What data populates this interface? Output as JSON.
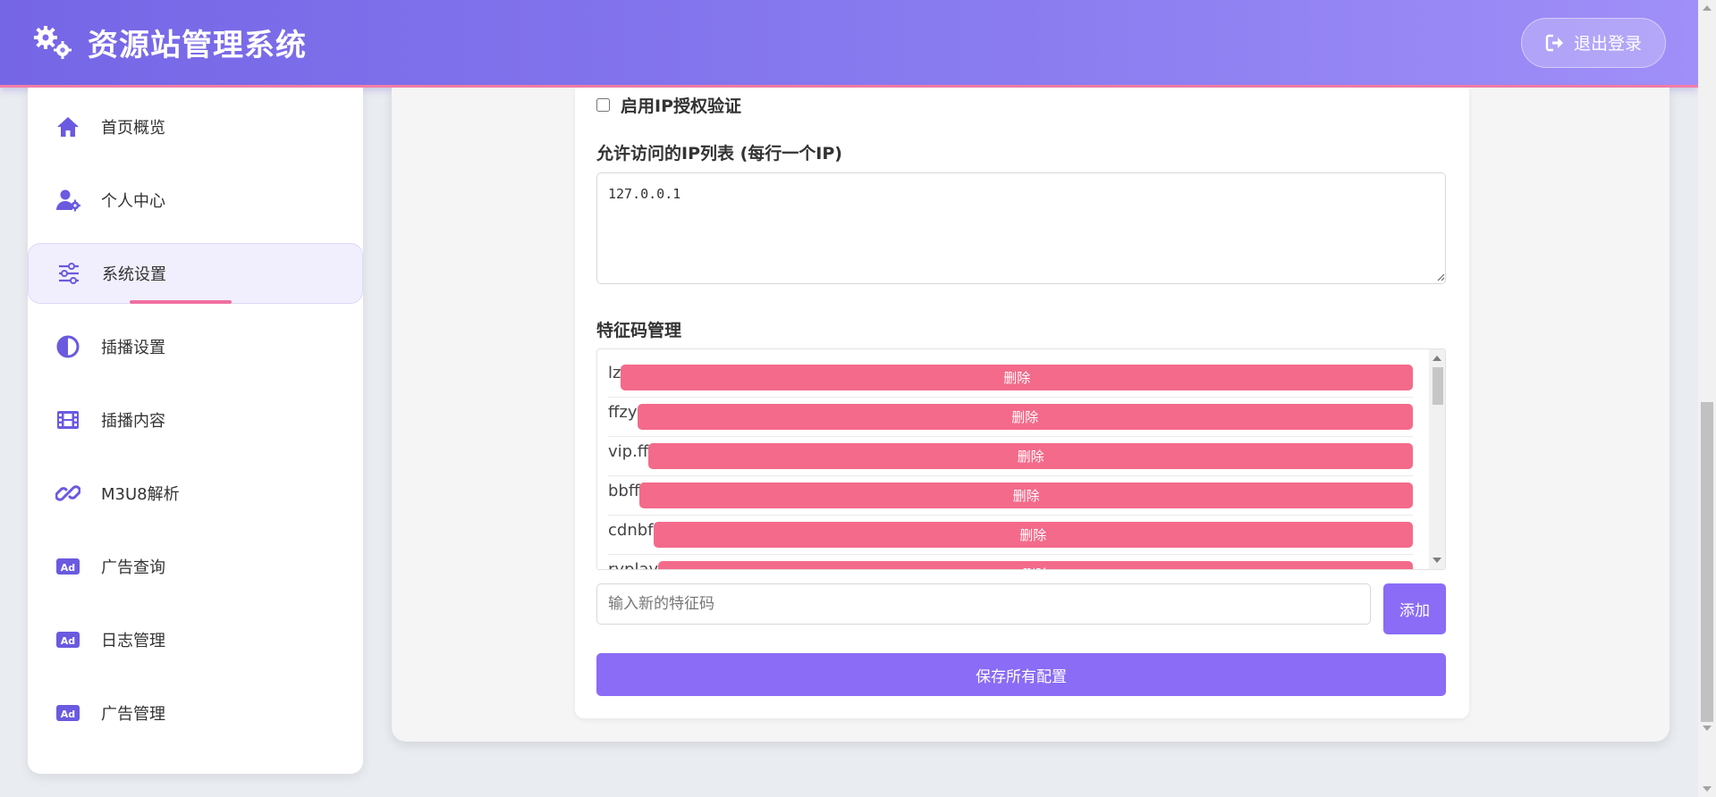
{
  "header": {
    "title": "资源站管理系统",
    "logo_icon": "gears-icon",
    "logout_label": "退出登录",
    "logout_icon": "sign-out-icon"
  },
  "sidebar": {
    "items": [
      {
        "label": "首页概览",
        "icon": "home-icon",
        "active": false
      },
      {
        "label": "个人中心",
        "icon": "user-gear-icon",
        "active": false
      },
      {
        "label": "系统设置",
        "icon": "sliders-icon",
        "active": true
      },
      {
        "label": "插播设置",
        "icon": "half-circle-icon",
        "active": false
      },
      {
        "label": "插播内容",
        "icon": "film-icon",
        "active": false
      },
      {
        "label": "M3U8解析",
        "icon": "link-icon",
        "active": false
      },
      {
        "label": "广告查询",
        "icon": "ad-icon",
        "active": false
      },
      {
        "label": "日志管理",
        "icon": "ad-icon",
        "active": false
      },
      {
        "label": "广告管理",
        "icon": "ad-icon",
        "active": false
      }
    ]
  },
  "settings": {
    "ip_auth_label": "启用IP授权验证",
    "ip_auth_checked": false,
    "ip_list_label": "允许访问的IP列表 (每行一个IP)",
    "ip_list_value": "127.0.0.1",
    "feature_title": "特征码管理",
    "delete_label": "删除",
    "features": [
      "lz",
      "ffzy",
      "vip.ff",
      "bbff",
      "cdnbf",
      "ryplay"
    ],
    "new_feature_placeholder": "输入新的特征码",
    "add_label": "添加",
    "save_label": "保存所有配置"
  },
  "colors": {
    "header_gradient_start": "#7566e6",
    "header_gradient_end": "#a08ff8",
    "accent_purple": "#8a6cf6",
    "delete_pink": "#f46a8a",
    "active_underline": "#f06fa0",
    "icon_purple": "#6a5ae0"
  }
}
